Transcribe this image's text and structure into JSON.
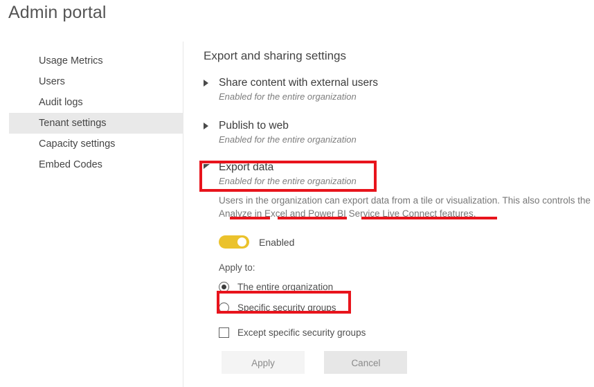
{
  "app": {
    "title": "Admin portal"
  },
  "sidebar": {
    "items": [
      {
        "label": "Usage Metrics",
        "name": "usage-metrics",
        "selected": false
      },
      {
        "label": "Users",
        "name": "users",
        "selected": false
      },
      {
        "label": "Audit logs",
        "name": "audit-logs",
        "selected": false
      },
      {
        "label": "Tenant settings",
        "name": "tenant-settings",
        "selected": true
      },
      {
        "label": "Capacity settings",
        "name": "capacity-settings",
        "selected": false
      },
      {
        "label": "Embed Codes",
        "name": "embed-codes",
        "selected": false
      }
    ]
  },
  "content": {
    "title": "Export and sharing settings",
    "settings": [
      {
        "name": "Share content with external users",
        "state": "Enabled for the entire organization",
        "expanded": false
      },
      {
        "name": "Publish to web",
        "state": "Enabled for the entire organization",
        "expanded": false
      },
      {
        "name": "Export data",
        "state": "Enabled for the entire organization",
        "expanded": true
      }
    ],
    "export_panel": {
      "description": "Users in the organization can export data from a tile or visualization. This also controls the Analyze in Excel and Power BI Service Live Connect features.",
      "toggle": {
        "label": "Enabled",
        "on": true,
        "color": "#ebc22c"
      },
      "apply_to_label": "Apply to:",
      "options": [
        {
          "type": "radio",
          "label": "The entire organization",
          "checked": true
        },
        {
          "type": "radio",
          "label": "Specific security groups",
          "checked": false
        },
        {
          "type": "checkbox",
          "label": "Except specific security groups",
          "checked": false
        }
      ],
      "buttons": {
        "apply": "Apply",
        "cancel": "Cancel"
      }
    }
  },
  "annotations": {
    "color": "#e8141c",
    "boxes": [
      {
        "target": "export-data-header"
      },
      {
        "target": "specific-security-groups-option"
      }
    ],
    "underlines": [
      {
        "target": "analyze-text"
      },
      {
        "target": "in-excel-and-power-bi-text"
      },
      {
        "target": "service-live-connect-features-text"
      }
    ]
  }
}
